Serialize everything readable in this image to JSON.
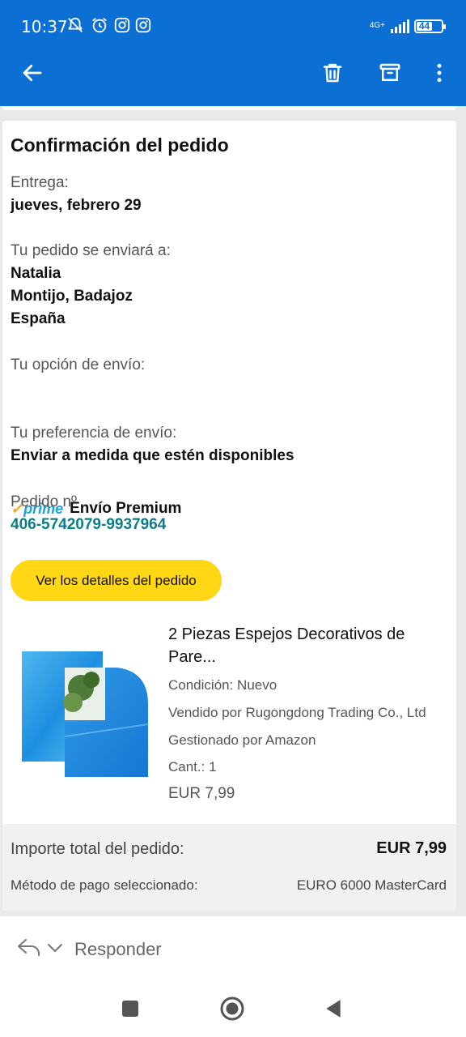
{
  "status_bar": {
    "time": "10:37",
    "network": "4G+",
    "battery": "44",
    "icons": [
      "notifications-off-icon",
      "alarm-icon",
      "instagram-icon",
      "instagram-icon"
    ]
  },
  "app_bar": {
    "back_icon": "arrow-left-icon",
    "actions": [
      "delete-icon",
      "archive-icon",
      "more-vert-icon"
    ]
  },
  "email": {
    "title": "Confirmación del pedido",
    "delivery_label": "Entrega:",
    "delivery_value": "jueves, febrero 29",
    "ship_to_label": "Tu pedido se enviará a:",
    "ship_to_name": "Natalia",
    "ship_to_city": "Montijo, Badajoz",
    "ship_to_country": "España",
    "shipping_option_label": "Tu opción de envío:",
    "prime_logo_text": "prime",
    "shipping_option_value": "Envío Premium",
    "shipping_pref_label": "Tu preferencia de envío:",
    "shipping_pref_value": "Enviar a medida que estén disponibles",
    "order_label": "Pedido nº",
    "order_number": "406-5742079-9937964",
    "details_button": "Ver los detalles del pedido",
    "product": {
      "title": "2 Piezas Espejos Decorativos de Pare...",
      "condition": "Condición: Nuevo",
      "seller": "Vendido por Rugongdong Trading Co., Ltd",
      "fulfilled": "Gestionado por Amazon",
      "quantity": "Cant.: 1",
      "price": "EUR 7,99"
    },
    "total_label": "Importe total del pedido:",
    "total_value": "EUR 7,99",
    "payment_label": "Método de pago seleccionado:",
    "payment_value": "EURO 6000 MasterCard"
  },
  "reply_bar": {
    "label": "Responder"
  },
  "colors": {
    "app_bar": "#0b6fd4",
    "button_yellow": "#ffd714",
    "order_link": "#0b7d87",
    "prime_blue": "#1aa2e0",
    "prime_orange": "#f2a31b"
  }
}
